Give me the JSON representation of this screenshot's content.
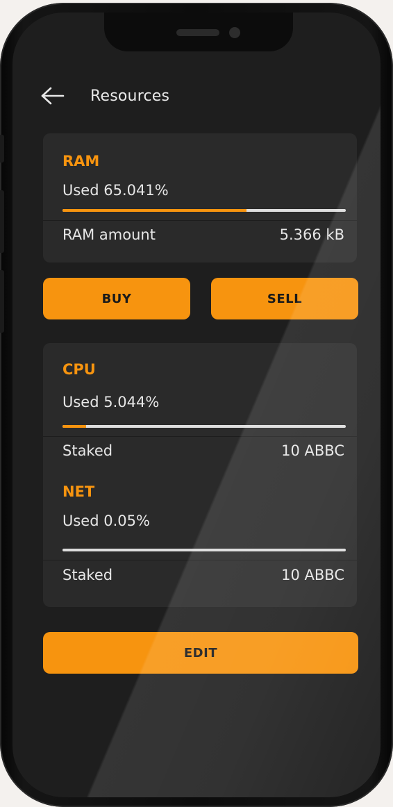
{
  "header": {
    "title": "Resources"
  },
  "ram": {
    "title": "RAM",
    "used_text": "Used 65.041%",
    "used_fraction": 0.65041,
    "amount_label": "RAM amount",
    "amount_value": "5.366 kB"
  },
  "actions": {
    "buy_label": "BUY",
    "sell_label": "SELL"
  },
  "cpu": {
    "title": "CPU",
    "used_text": "Used 5.044%",
    "used_fraction": 0.05044,
    "staked_label": "Staked",
    "staked_value": "10 ABBC"
  },
  "net": {
    "title": "NET",
    "used_text": "Used 0.05%",
    "used_fraction": 0.0005,
    "staked_label": "Staked",
    "staked_value": "10 ABBC"
  },
  "footer": {
    "edit_label": "EDIT"
  },
  "colors": {
    "accent": "#f7940f",
    "card": "#2a2a2a",
    "screen": "#1e1e1e",
    "track": "#dddddd"
  },
  "icons": {
    "back": "arrow-left-icon"
  }
}
